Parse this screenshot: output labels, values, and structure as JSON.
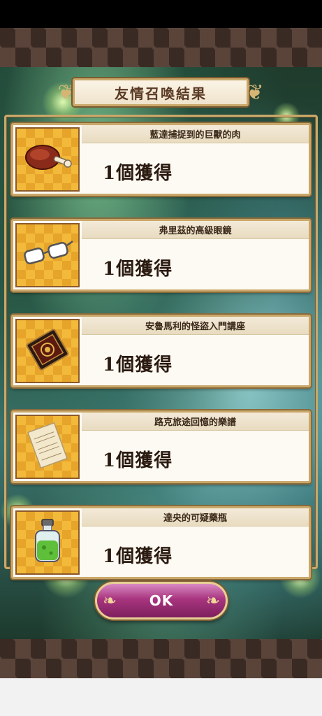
{
  "title": "友情召喚結果",
  "items": [
    {
      "name": "藍達捕捉到的巨獸的肉",
      "count": "1個獲得",
      "icon": "meat-icon"
    },
    {
      "name": "弗里茲的高級眼鏡",
      "count": "1個獲得",
      "icon": "glasses-icon"
    },
    {
      "name": "安魯馬利的怪盜入門講座",
      "count": "1個獲得",
      "icon": "book-icon"
    },
    {
      "name": "路克旅途回憶的樂譜",
      "count": "1個獲得",
      "icon": "sheet-music-icon"
    },
    {
      "name": "達央的可疑藥瓶",
      "count": "1個獲得",
      "icon": "potion-bottle-icon"
    }
  ],
  "ok_label": "OK",
  "colors": {
    "frame": "#c9a86a",
    "ok_button": "#a8357f",
    "icon_bg": "#f2b93a"
  }
}
